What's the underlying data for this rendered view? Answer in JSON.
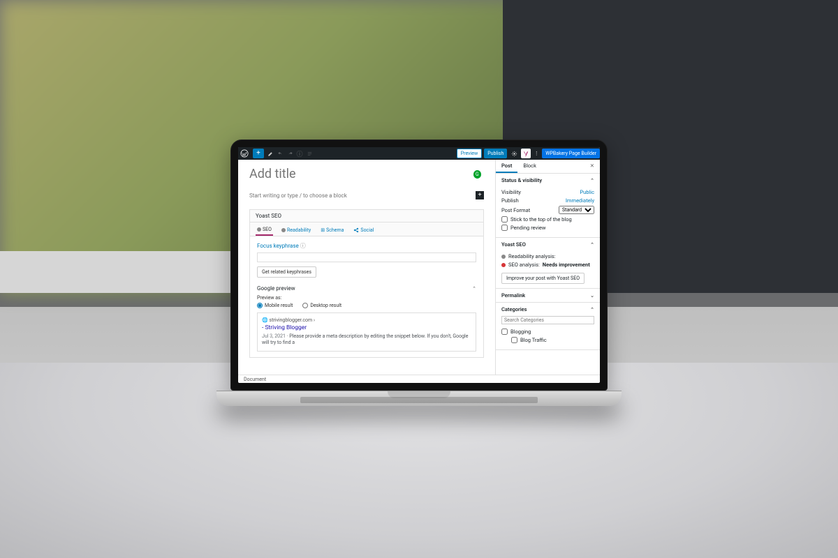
{
  "topbar": {
    "preview": "Preview",
    "publish": "Publish",
    "bakery": "WPBakery Page Builder"
  },
  "editor": {
    "title_placeholder": "Add title",
    "block_placeholder": "Start writing or type / to choose a block"
  },
  "yoast": {
    "heading": "Yoast SEO",
    "tabs": {
      "seo": "SEO",
      "readability": "Readability",
      "schema": "Schema",
      "social": "Social"
    },
    "focus_label": "Focus keyphrase",
    "related_btn": "Get related keyphrases",
    "gprev": {
      "title": "Google preview",
      "preview_as": "Preview as:",
      "mobile": "Mobile result",
      "desktop": "Desktop result",
      "breadcrumb": "strivingblogger.com ›",
      "site_title": "- Striving Blogger",
      "date": "Jul 3, 2021",
      "meta": "Please provide a meta description by editing the snippet below. If you don't, Google will try to find a"
    }
  },
  "statusbar": {
    "doc": "Document"
  },
  "sidebar": {
    "tabs": {
      "post": "Post",
      "block": "Block"
    },
    "status": {
      "title": "Status & visibility",
      "visibility_k": "Visibility",
      "visibility_v": "Public",
      "publish_k": "Publish",
      "publish_v": "Immediately",
      "format_k": "Post Format",
      "format_v": "Standard",
      "stick": "Stick to the top of the blog",
      "pending": "Pending review"
    },
    "yoast_panel": {
      "title": "Yoast SEO",
      "readability": "Readability analysis:",
      "seo_k": "SEO analysis:",
      "seo_v": "Needs improvement",
      "improve": "Improve your post with Yoast SEO"
    },
    "permalink": {
      "title": "Permalink"
    },
    "categories": {
      "title": "Categories",
      "search_ph": "Search Categories",
      "blogging": "Blogging",
      "blog_traffic": "Blog Traffic"
    }
  }
}
